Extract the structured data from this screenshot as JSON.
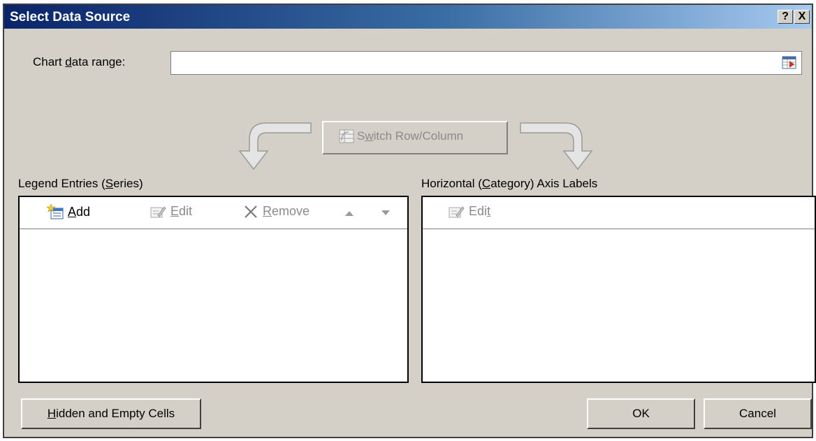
{
  "window": {
    "title": "Select Data Source",
    "help_label": "?",
    "close_label": "X"
  },
  "range": {
    "label_pre": "Chart ",
    "label_accel": "d",
    "label_post": "ata range:",
    "value": ""
  },
  "switch": {
    "label_pre": "S",
    "label_accel": "w",
    "label_post": "itch Row/Column"
  },
  "legend": {
    "label_pre": "Legend Entries (",
    "label_accel": "S",
    "label_post": "eries)",
    "add_accel": "A",
    "add_rest": "dd",
    "edit_accel": "E",
    "edit_rest": "dit",
    "remove_accel": "R",
    "remove_rest": "emove",
    "items": []
  },
  "axis": {
    "label_pre": "Horizontal (",
    "label_accel": "C",
    "label_post": "ategory) Axis Labels",
    "edit_pre": "Edi",
    "edit_accel": "t",
    "items": []
  },
  "footer": {
    "hidden_accel": "H",
    "hidden_rest": "idden and Empty Cells",
    "ok_label": "OK",
    "cancel_label": "Cancel"
  },
  "colors": {
    "dialog_bg": "#d4d0c8",
    "title_start": "#0a246a",
    "title_end": "#a6caf0",
    "disabled_text": "#8a8a8a"
  }
}
